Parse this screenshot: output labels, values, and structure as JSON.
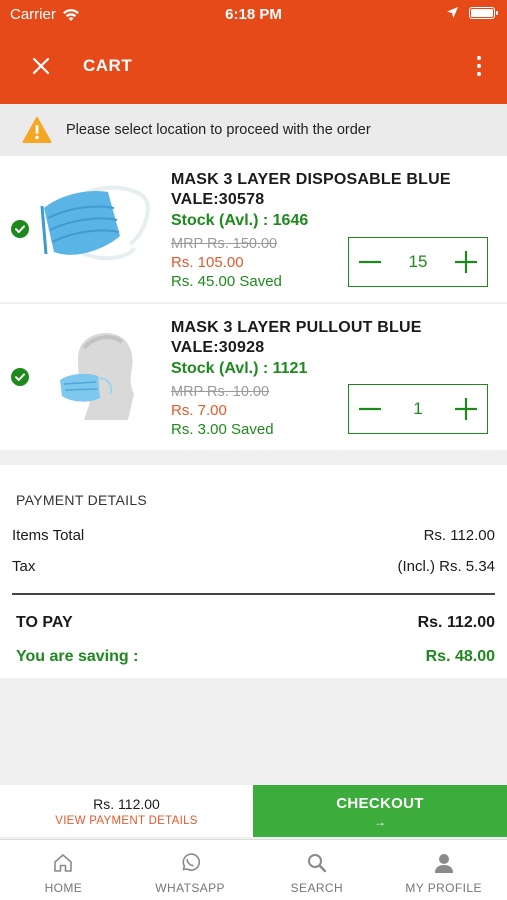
{
  "status_bar": {
    "carrier": "Carrier",
    "time": "6:18 PM"
  },
  "header": {
    "title": "CART"
  },
  "notice": {
    "message": "Please select location to proceed with the order"
  },
  "items": [
    {
      "name_line1": "MASK 3 LAYER DISPOSABLE BLUE",
      "name_line2": "VALE:30578",
      "stock": "Stock (Avl.) : 1646",
      "mrp": "MRP Rs. 150.00",
      "price": "Rs. 105.00",
      "saved": "Rs. 45.00 Saved",
      "quantity": "15",
      "image": "blue-surgical-mask-icon"
    },
    {
      "name_line1": "MASK 3 LAYER PULLOUT BLUE",
      "name_line2": "VALE:30928",
      "stock": "Stock (Avl.) : 1121",
      "mrp": "MRP Rs. 10.00",
      "price": "Rs. 7.00",
      "saved": "Rs. 3.00 Saved",
      "quantity": "1",
      "image": "mannequin-with-mask-icon"
    }
  ],
  "payment": {
    "heading": "PAYMENT DETAILS",
    "items_total_label": "Items Total",
    "items_total_value": "Rs. 112.00",
    "tax_label": "Tax",
    "tax_value": "(Incl.) Rs. 5.34",
    "to_pay_label": "TO PAY",
    "to_pay_value": "Rs. 112.00",
    "saving_label": "You are saving :",
    "saving_value": "Rs. 48.00"
  },
  "footer": {
    "amount": "Rs. 112.00",
    "view_details": "VIEW PAYMENT DETAILS",
    "checkout": "CHECKOUT",
    "checkout_arrow": "→"
  },
  "tabs": [
    {
      "label": "HOME",
      "icon": "home-icon"
    },
    {
      "label": "WHATSAPP",
      "icon": "whatsapp-icon"
    },
    {
      "label": "SEARCH",
      "icon": "search-icon"
    },
    {
      "label": "MY PROFILE",
      "icon": "profile-icon"
    }
  ],
  "colors": {
    "brand": "#e64a19",
    "green": "#1e8a1e",
    "checkout": "#3cac3c",
    "price_orange": "#e35a2d"
  }
}
